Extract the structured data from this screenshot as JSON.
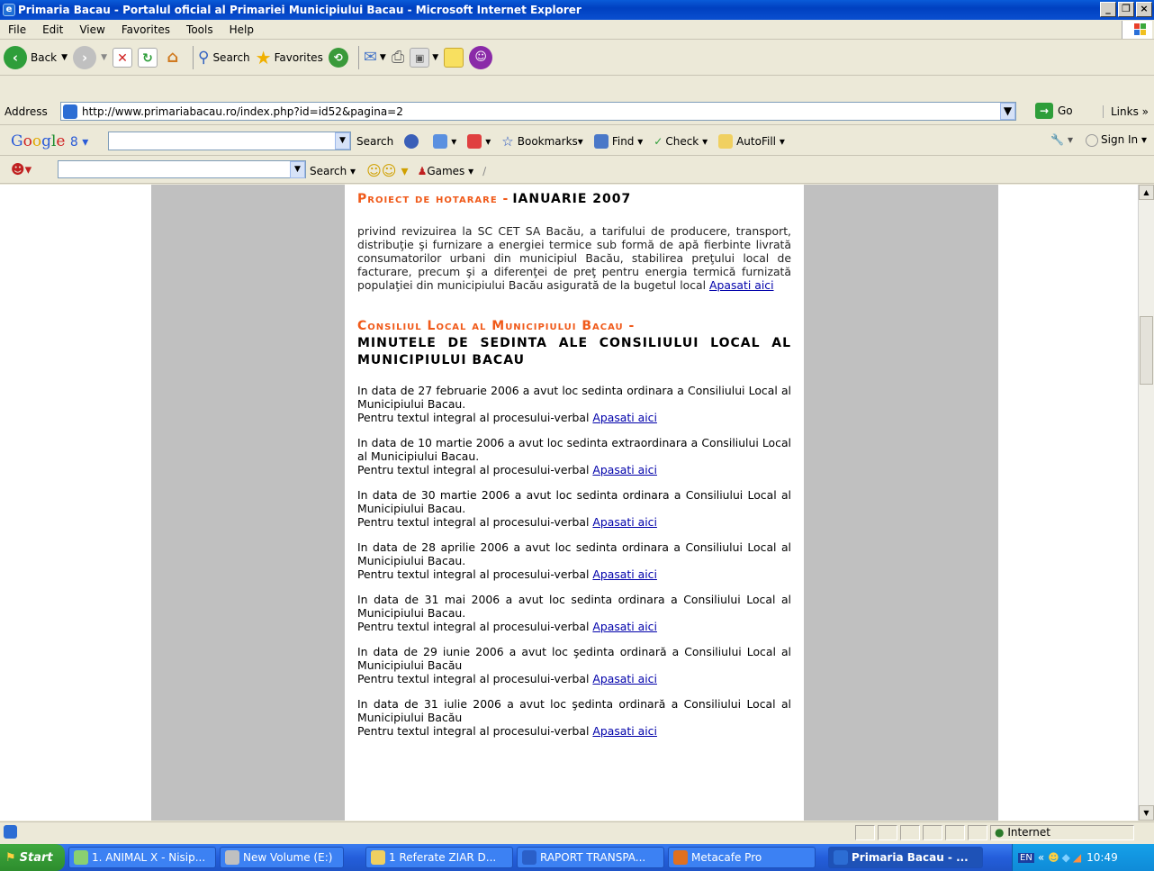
{
  "window": {
    "title": "Primaria Bacau - Portalul oficial al Primariei Municipiului Bacau - Microsoft Internet Explorer"
  },
  "menu": [
    "File",
    "Edit",
    "View",
    "Favorites",
    "Tools",
    "Help"
  ],
  "toolbar": {
    "back_label": "Back",
    "search_label": "Search",
    "favorites_label": "Favorites"
  },
  "address": {
    "label": "Address",
    "url": "http://www.primariabacau.ro/index.php?id=id52&pagina=2",
    "go_label": "Go",
    "links_label": "Links"
  },
  "google_bar": {
    "search_label": "Search",
    "bookmarks_label": "Bookmarks",
    "find_label": "Find",
    "check_label": "Check",
    "autofill_label": "AutoFill",
    "signin_label": "Sign In"
  },
  "smiley_bar": {
    "search_label": "Search",
    "games_label": "Games"
  },
  "page": {
    "section1_title": "Proiect de hotarare -",
    "section1_date": "IANUARIE 2007",
    "section1_text": "privind revizuirea la SC CET SA Bacău, a tarifului de producere, transport, distribuţie şi furnizare a energiei termice sub formă de apă fierbinte livrată consumatorilor urbani din municipiul Bacău, stabilirea preţului local de facturare, precum şi a diferenţei de preţ pentru energia termică furnizată populaţiei din municipiului Bacău asigurată de la bugetul local",
    "link_text": "Apasati aici",
    "section2_title": "Consiliul Local al Municipiului Bacau -",
    "section2_subtitle": "MINUTELE DE SEDINTA ALE CONSILIULUI LOCAL AL MUNICIPIULUI BACAU",
    "entry_prefix": "Pentru textul integral al procesului-verbal",
    "entries": [
      {
        "text": "In data de 27 februarie 2006 a avut loc sedinta ordinara a Consiliului Local al Municipiului Bacau."
      },
      {
        "text": "In data de 10 martie 2006 a avut loc sedinta extraordinara a Consiliului Local al Municipiului Bacau."
      },
      {
        "text": "In data de 30 martie 2006 a avut loc sedinta ordinara a Consiliului Local al Municipiului Bacau."
      },
      {
        "text": "In data de 28 aprilie 2006 a avut loc sedinta ordinara a Consiliului Local al Municipiului Bacau."
      },
      {
        "text": "In data de 31 mai 2006 a avut loc sedinta ordinara a Consiliului Local al Municipiului Bacau."
      },
      {
        "text": "In data de 29 iunie 2006 a avut loc şedinta ordinară a Consiliului Local al Municipiului Bacău"
      },
      {
        "text": "In data de 31 iulie 2006 a avut loc şedinta ordinară a Consiliului Local al Municipiului Bacău"
      }
    ]
  },
  "status": {
    "zone": "Internet"
  },
  "taskbar": {
    "start_label": "Start",
    "tasks": [
      "1. ANIMAL X - Nisip...",
      "New Volume (E:)",
      "1 Referate  ZIAR D...",
      "RAPORT TRANSPA...",
      "Metacafe Pro",
      "Primaria Bacau - ..."
    ],
    "lang": "EN",
    "clock": "10:49"
  }
}
